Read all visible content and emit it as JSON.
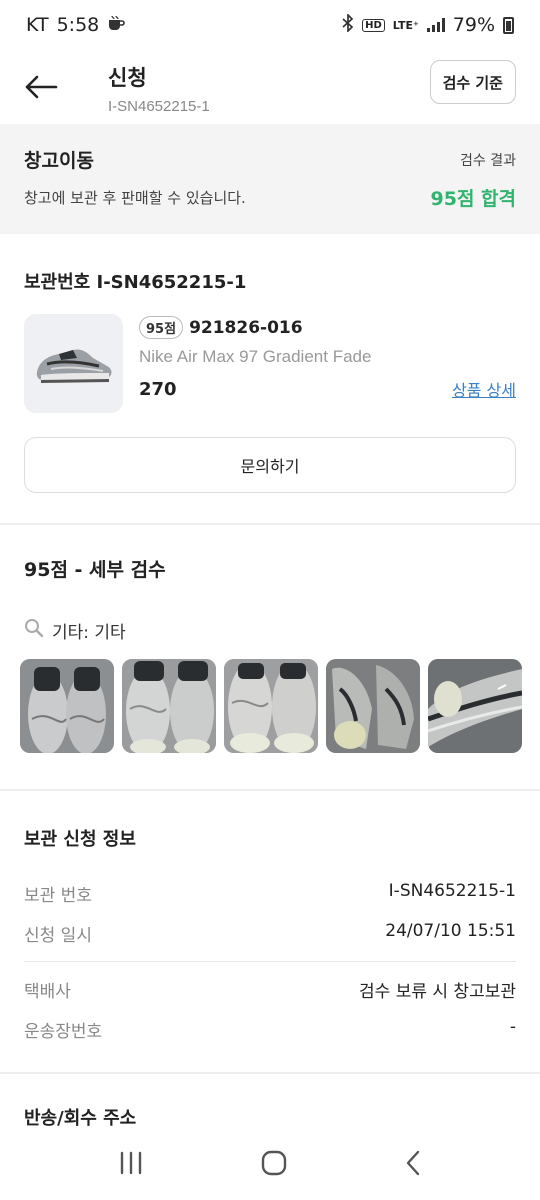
{
  "status_bar": {
    "carrier": "KT",
    "time": "5:58",
    "network": "LTE⁺",
    "battery": "79%"
  },
  "header": {
    "title": "신청",
    "subtitle": "I-SN4652215-1",
    "criteria_button": "검수 기준"
  },
  "banner": {
    "title": "창고이동",
    "description": "창고에 보관 후 판매할 수 있습니다.",
    "result_label": "검수 결과",
    "result_value": "95점 합격",
    "accent": "#31b46e"
  },
  "storage": {
    "title": "보관번호 I-SN4652215-1",
    "product": {
      "score_badge": "95점",
      "model_number": "921826-016",
      "name": "Nike Air Max 97 Gradient Fade",
      "size": "270",
      "detail_link": "상품 상세"
    },
    "inquiry_button": "문의하기"
  },
  "inspection": {
    "title": "95점 - 세부 검수",
    "category": "기타: 기타"
  },
  "storage_info": {
    "title": "보관 신청 정보",
    "rows": [
      {
        "label": "보관 번호",
        "value": "I-SN4652215-1"
      },
      {
        "label": "신청 일시",
        "value": "24/07/10 15:51"
      },
      {
        "label": "택배사",
        "value": "검수 보류 시 창고보관"
      },
      {
        "label": "운송장번호",
        "value": "-"
      }
    ]
  },
  "return_address": {
    "title": "반송/회수 주소"
  }
}
